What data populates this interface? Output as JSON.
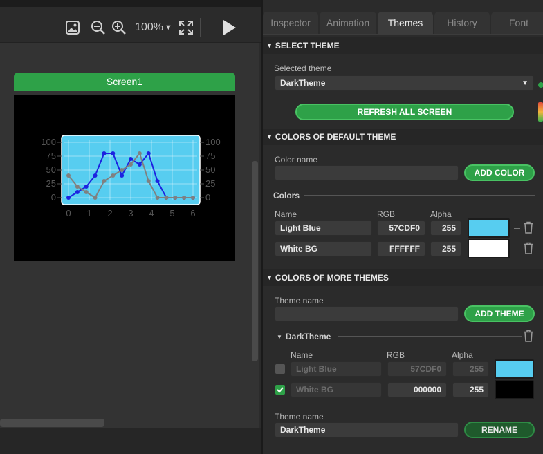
{
  "toolbar": {
    "zoom": "100%",
    "zoom_arrow": "▼"
  },
  "screen": {
    "title": "Screen1"
  },
  "chart_data": {
    "type": "line",
    "x": [
      0,
      0.5,
      1,
      1.5,
      2,
      2.5,
      3,
      3.5,
      4,
      4.5,
      5,
      5.5,
      6
    ],
    "series": [
      {
        "values": [
          0,
          10,
          20,
          40,
          80,
          80,
          40,
          70,
          60,
          80,
          30,
          0,
          0,
          0,
          0
        ]
      },
      {
        "values": [
          40,
          20,
          10,
          0,
          30,
          40,
          50,
          60,
          80,
          30,
          0,
          0,
          0,
          0,
          0
        ]
      }
    ],
    "xticks": [
      "0",
      "1",
      "2",
      "3",
      "4",
      "5",
      "6"
    ],
    "yticks_left": [
      "100",
      "75",
      "50",
      "25",
      "0"
    ],
    "yticks_right": [
      "100",
      "75",
      "50",
      "25",
      "0"
    ],
    "ylim": [
      0,
      100
    ],
    "grid": true,
    "colors": {
      "series1": "#1c22e0",
      "series2": "#808080",
      "plot_bg": "#57CDF0",
      "ticks": "#555555"
    }
  },
  "tabs": [
    "Inspector",
    "Animation",
    "Themes",
    "History",
    "Font"
  ],
  "active_tab": "Themes",
  "select_theme": {
    "header": "SELECT THEME",
    "label": "Selected theme",
    "value": "DarkTheme",
    "refresh_label": "REFRESH ALL SCREEN"
  },
  "default_colors": {
    "header": "COLORS OF DEFAULT THEME",
    "color_name_label": "Color name",
    "color_name_value": "",
    "add_color_label": "ADD COLOR",
    "colors_label": "Colors",
    "col_name": "Name",
    "col_rgb": "RGB",
    "col_alpha": "Alpha",
    "rows": [
      {
        "name": "Light Blue",
        "rgb": "57CDF0",
        "alpha": "255",
        "swatch": "#57CDF0"
      },
      {
        "name": "White BG",
        "rgb": "FFFFFF",
        "alpha": "255",
        "swatch": "#FFFFFF"
      }
    ]
  },
  "more_themes": {
    "header": "COLORS OF MORE THEMES",
    "theme_name_label": "Theme name",
    "theme_name_value": "",
    "add_theme_label": "ADD THEME",
    "theme_title": "DarkTheme",
    "col_name": "Name",
    "col_rgb": "RGB",
    "col_alpha": "Alpha",
    "rows": [
      {
        "checked": false,
        "name": "Light Blue",
        "rgb": "57CDF0",
        "alpha": "255",
        "swatch": "#57CDF0"
      },
      {
        "checked": true,
        "name": "White BG",
        "rgb": "000000",
        "alpha": "255",
        "swatch": "#000000"
      }
    ],
    "rename_label": "Theme name",
    "rename_value": "DarkTheme",
    "rename_button": "RENAME"
  },
  "colors": {
    "accent_green": "#2ea148",
    "panel_bg": "#2b2b2b"
  }
}
